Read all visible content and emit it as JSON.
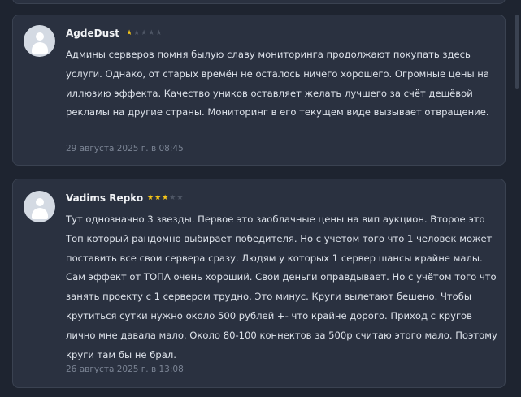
{
  "reviews": [
    {
      "author": "AgdeDust",
      "rating": 1,
      "max_rating": 5,
      "text": "Админы серверов помня былую славу мониторинга продолжают покупать здесь услуги. Однако, от старых времён не осталось ничего хорошего. Огромные цены на иллюзию эффекта. Качество уников оставляет желать лучшего за счёт дешёвой рекламы на другие страны. Мониторинг в его текущем виде вызывает отвращение.",
      "date": "29 августа 2025 г. в 08:45"
    },
    {
      "author": "Vadims Repko",
      "rating": 3,
      "max_rating": 5,
      "text": "Тут однозначно 3 звезды. Первое это заоблачные цены на вип аукцион. Второе это Топ который рандомно выбирает победителя. Но с учетом того что 1 человек может поставить все свои сервера сразу. Людям у которых 1 сервер шансы крайне малы. Сам эффект от ТОПА очень хороший. Свои деньги оправдывает. Но с учётом того что занять проекту с 1 сервером трудно. Это минус. Круги вылетают  бешено. Чтобы крутиться сутки нужно около 500 рублей +- что крайне дорого. Приход с кругов лично мне давала мало. Около 80-100 коннектов за 500р считаю этого мало. Поэтому круги там бы не брал.",
      "date": "26 августа 2025 г. в 13:08"
    }
  ],
  "colors": {
    "background": "#1e2430",
    "card": "#2a3140",
    "star_filled": "#f5c518",
    "star_empty": "#4e5665"
  }
}
